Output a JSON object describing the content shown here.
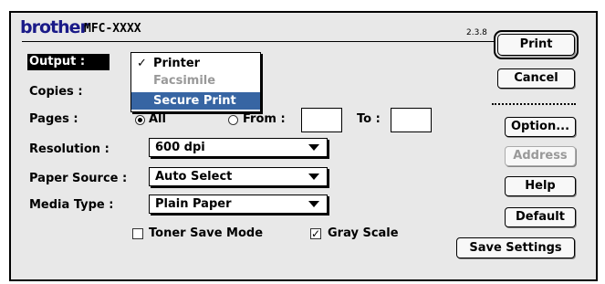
{
  "header": {
    "brand": "brother",
    "model": "MFC-XXXX",
    "version": "2.3.8"
  },
  "labels": {
    "output": "Output :",
    "copies": "Copies :",
    "pages": "Pages :",
    "resolution": "Resolution :",
    "paper_source": "Paper Source :",
    "media_type": "Media Type :"
  },
  "output_menu": {
    "items": [
      {
        "label": "Printer",
        "checked": true
      },
      {
        "label": "Facsimile",
        "disabled": true
      },
      {
        "label": "Secure Print",
        "highlighted": true
      }
    ]
  },
  "pages": {
    "all_label": "All",
    "from_label": "From :",
    "to_label": "To :",
    "from_value": "",
    "to_value": "",
    "selected": "All"
  },
  "resolution": {
    "value": "600 dpi"
  },
  "paper_source": {
    "value": "Auto Select"
  },
  "media_type": {
    "value": "Plain Paper"
  },
  "options": {
    "toner_save_label": "Toner Save Mode",
    "toner_save_checked": false,
    "gray_scale_label": "Gray Scale",
    "gray_scale_checked": true
  },
  "buttons": {
    "print": "Print",
    "cancel": "Cancel",
    "option": "Option...",
    "address": "Address",
    "help": "Help",
    "default": "Default",
    "save_settings": "Save Settings"
  }
}
